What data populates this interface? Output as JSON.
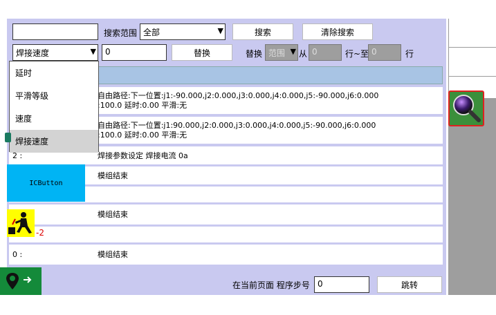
{
  "toolbar": {
    "search_input_value": "",
    "search_range_label": "搜索范围",
    "search_range_value": "全部",
    "search_button": "搜索",
    "clear_search_button": "清除搜索",
    "field_select_value": "焊接速度",
    "replace_input_value": "0",
    "replace_button": "替换",
    "replace_scope_label": "替换",
    "scope_select_value": "范围",
    "from_label": "从",
    "from_value": "0",
    "to_label": "行~至",
    "to_value": "0",
    "row_suffix": "行"
  },
  "dropdown": {
    "items": [
      "延时",
      "平滑等级",
      "速度",
      "焊接速度"
    ],
    "selected": "焊接速度"
  },
  "rows": [
    {
      "index": "",
      "line1": "自由路径:下一位置:j1:-90.000,j2:0.000,j3:0.000,j4:0.000,j5:-90.000,j6:0.000",
      "line2": ":100.0 延时:0.00 平滑:无"
    },
    {
      "index": "",
      "line1": "自由路径:下一位置:j1:90.000,j2:0.000,j3:0.000,j4:0.000,j5:-90.000,j6:0.000",
      "line2": ":100.0 延时:0.00 平滑:无"
    },
    {
      "index": "2 :",
      "line1": "焊接参数设定 焊接电流 0a",
      "line2": ""
    },
    {
      "index": "",
      "line1": "模组结束",
      "line2": ""
    },
    {
      "index": "",
      "line1": "",
      "line2": ""
    },
    {
      "index": "",
      "line1": "模组结束",
      "line2": ""
    },
    {
      "index": "",
      "line1": "",
      "line2": ""
    },
    {
      "index": "0 :",
      "line1": "模组结束",
      "line2": ""
    }
  ],
  "overlay": {
    "icbutton_label": "ICButton",
    "minus_label": "-2"
  },
  "footer": {
    "current_page_label": "在当前页面 程序步号",
    "step_value": "0",
    "jump_button": "跳转"
  },
  "colors": {
    "panel": "#c9c9f0",
    "header_strip": "#a8c4e4",
    "icbutton": "#00b4f4",
    "worker_bg": "#ffff00",
    "nav_green": "#148a3a",
    "search_border": "#e02020"
  },
  "icons": {
    "search_big": "magnifier-icon",
    "worker": "worker-icon",
    "nav": "location-arrow-icon"
  }
}
